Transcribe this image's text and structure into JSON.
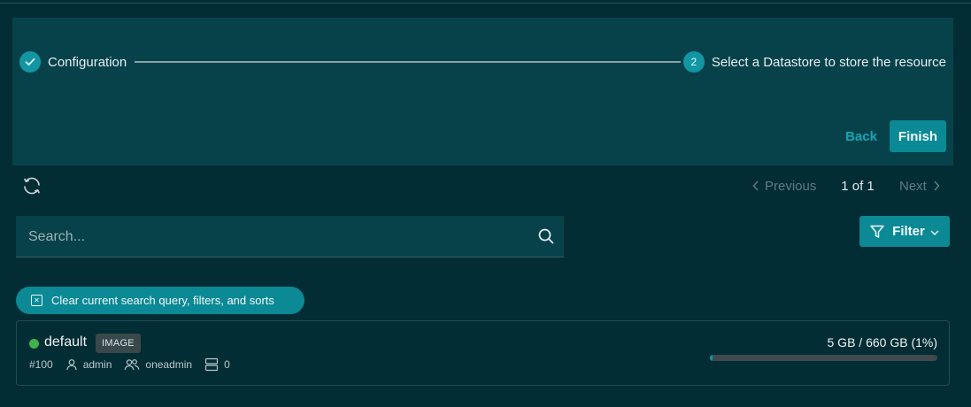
{
  "stepper": {
    "steps": [
      {
        "label": "Configuration",
        "state": "done"
      },
      {
        "label": "Select a Datastore to store the resource",
        "number": "2",
        "state": "active"
      }
    ],
    "back_label": "Back",
    "finish_label": "Finish"
  },
  "pagination": {
    "prev_label": "Previous",
    "info": "1 of 1",
    "next_label": "Next"
  },
  "search": {
    "placeholder": "Search...",
    "value": ""
  },
  "filter": {
    "label": "Filter"
  },
  "clear_chip": {
    "label": "Clear current search query, filters, and sorts"
  },
  "datastores": [
    {
      "name": "default",
      "type_badge": "IMAGE",
      "id": "#100",
      "owner": "admin",
      "group": "oneadmin",
      "clusters": "0",
      "usage_text": "5 GB / 660 GB (1%)",
      "usage_percent": 1,
      "status_color": "#3fb34a"
    }
  ],
  "colors": {
    "accent": "#0b8995",
    "panel": "#07424b",
    "background": "#032d35"
  }
}
